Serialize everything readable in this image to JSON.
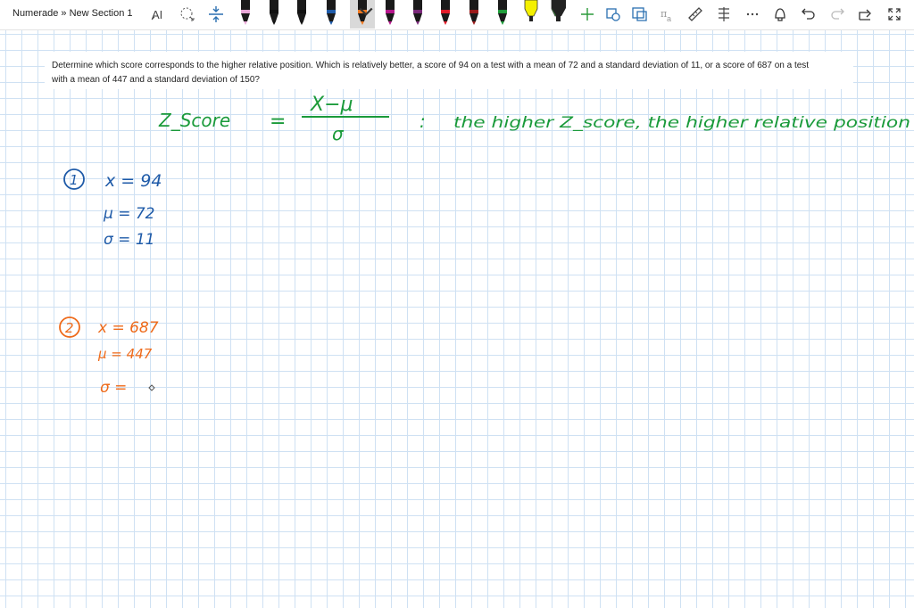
{
  "app": {
    "breadcrumb": "Numerade » New Section 1"
  },
  "toolbar": {
    "tools": [
      {
        "name": "lasso-type-icon"
      },
      {
        "name": "lasso-select-icon"
      },
      {
        "name": "insert-space-icon"
      }
    ],
    "pens": [
      {
        "name": "pen-pink-marker",
        "color": "#e8a6d6"
      },
      {
        "name": "pen-black-1",
        "color": "#111111"
      },
      {
        "name": "pen-black-2",
        "color": "#111111"
      },
      {
        "name": "pen-blue",
        "color": "#1e5aa8"
      },
      {
        "name": "pen-orange-selected",
        "color": "#f07820"
      },
      {
        "name": "pen-purple",
        "color": "#b5178c"
      },
      {
        "name": "pen-dark-purple",
        "color": "#7a2a7a"
      },
      {
        "name": "pen-red",
        "color": "#e21c2a"
      },
      {
        "name": "pen-dark-red",
        "color": "#9a1a1a"
      },
      {
        "name": "pen-green",
        "color": "#1f9c3a"
      },
      {
        "name": "highlighter-yellow",
        "color": "#f4f000"
      },
      {
        "name": "highlighter-green",
        "color": "#3cdc3c"
      },
      {
        "name": "highlighter-cyan",
        "color": "#22d0f0"
      },
      {
        "name": "pen-dark",
        "color": "#222222"
      }
    ],
    "right_icons": [
      "add-pen-icon",
      "ink-to-shape-icon",
      "ink-to-text-icon",
      "ink-to-math-icon",
      "ruler-icon",
      "ink-replay-icon",
      "more-icon",
      "touch-drawing-icon",
      "undo-icon",
      "redo-icon",
      "share-icon",
      "fullscreen-icon"
    ]
  },
  "question": {
    "line1": "Determine which score corresponds to the higher relative position. Which is relatively better, a score of 94 on a test with a mean of 72 and a standard deviation of 11, or a score of 687 on a test",
    "line2": "with a mean of 447 and a standard deviation of 150?"
  },
  "handwriting": {
    "green_color": "#1a9a3a",
    "blue_color": "#1e5aa8",
    "orange_color": "#ee6a1a",
    "formula_lhs": "Z_Score",
    "formula_eq": "=",
    "formula_num": "X−μ",
    "formula_den": "σ",
    "formula_colon": ":",
    "formula_note": "the higher Z_score, the higher relative position",
    "case1_label": "1",
    "case1_x": "x = 94",
    "case1_mu": "μ = 72",
    "case1_sigma": "σ = 11",
    "case2_label": "2",
    "case2_x": "x = 687",
    "case2_mu": "μ = 447",
    "case2_sigma": "σ ="
  }
}
